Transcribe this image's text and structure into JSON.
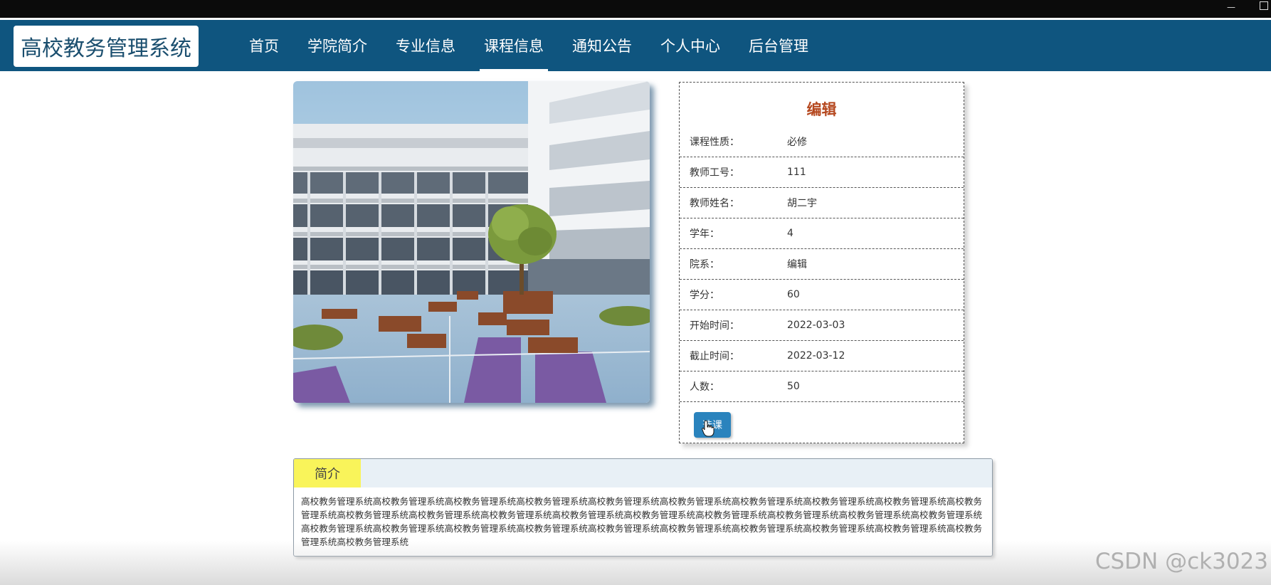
{
  "site": {
    "title": "高校教务管理系统"
  },
  "nav": {
    "items": [
      {
        "label": "首页"
      },
      {
        "label": "学院简介"
      },
      {
        "label": "专业信息"
      },
      {
        "label": "课程信息",
        "active": true
      },
      {
        "label": "通知公告"
      },
      {
        "label": "个人中心"
      },
      {
        "label": "后台管理"
      }
    ]
  },
  "detail": {
    "title": "编辑",
    "rows": [
      {
        "label": "课程性质：",
        "value": "必修"
      },
      {
        "label": "教师工号：",
        "value": "111"
      },
      {
        "label": "教师姓名：",
        "value": "胡二宇"
      },
      {
        "label": "学年：",
        "value": "4"
      },
      {
        "label": "院系：",
        "value": "编辑"
      },
      {
        "label": "学分：",
        "value": "60"
      },
      {
        "label": "开始时间：",
        "value": "2022-03-03"
      },
      {
        "label": "截止时间：",
        "value": "2022-03-12"
      },
      {
        "label": "人数：",
        "value": "50"
      }
    ],
    "select_button": "选课"
  },
  "intro": {
    "tab_label": "简介",
    "text": "高校教务管理系统高校教务管理系统高校教务管理系统高校教务管理系统高校教务管理系统高校教务管理系统高校教务管理系统高校教务管理系统高校教务管理系统高校教务管理系统高校教务管理系统高校教务管理系统高校教务管理系统高校教务管理系统高校教务管理系统高校教务管理系统高校教务管理系统高校教务管理系统高校教务管理系统高校教务管理系统高校教务管理系统高校教务管理系统高校教务管理系统高校教务管理系统高校教务管理系统高校教务管理系统高校教务管理系统高校教务管理系统高校教务管理系统高校教务管理系统"
  },
  "watermark": "CSDN @ck3023",
  "colors": {
    "header": "#0f557f",
    "accent_title": "#b5481f",
    "button": "#2a83bd",
    "tab_highlight": "#f9f45a"
  },
  "icons": {
    "cursor": "hand-pointer-icon",
    "window_minimize": "minimize-icon",
    "window_maximize": "maximize-icon"
  }
}
